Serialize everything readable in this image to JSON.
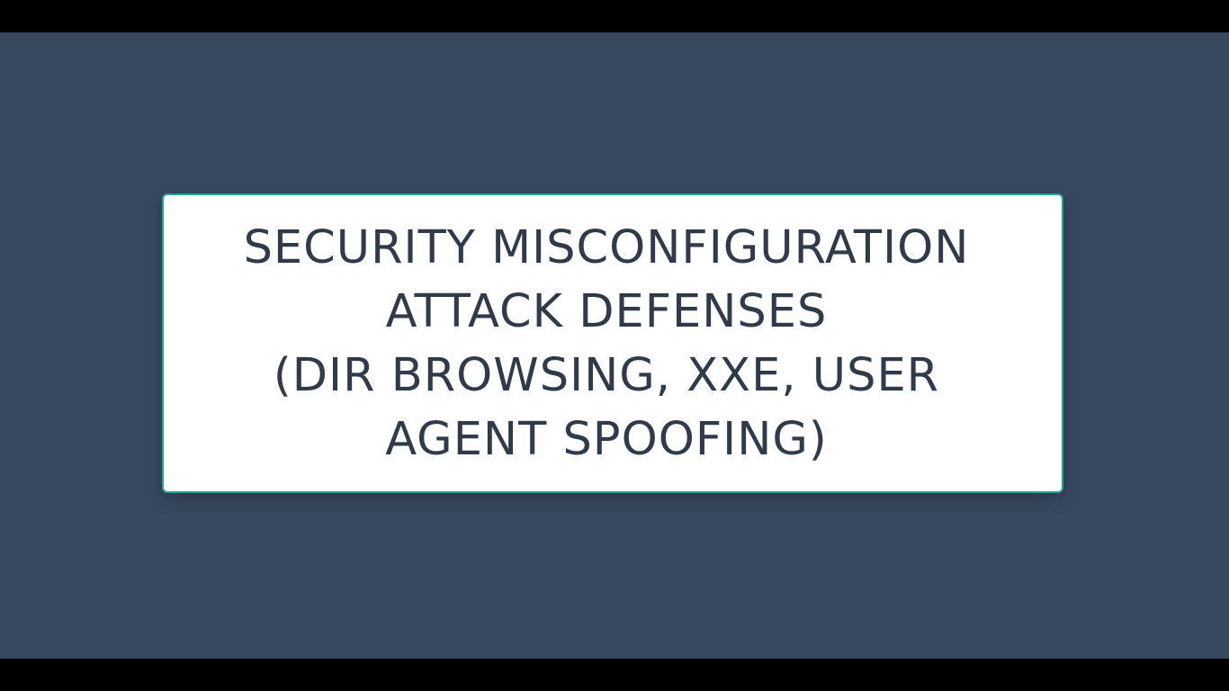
{
  "slide": {
    "title_lines": [
      "SECURITY MISCONFIGURATION",
      "ATTACK DEFENSES",
      "(DIR BROWSING, XXE, USER",
      "AGENT SPOOFING)"
    ]
  },
  "colors": {
    "background": "#38495f",
    "card": "#ffffff",
    "card_border": "#1fa595",
    "text": "#2f3a4a",
    "letterbox": "#000000"
  }
}
